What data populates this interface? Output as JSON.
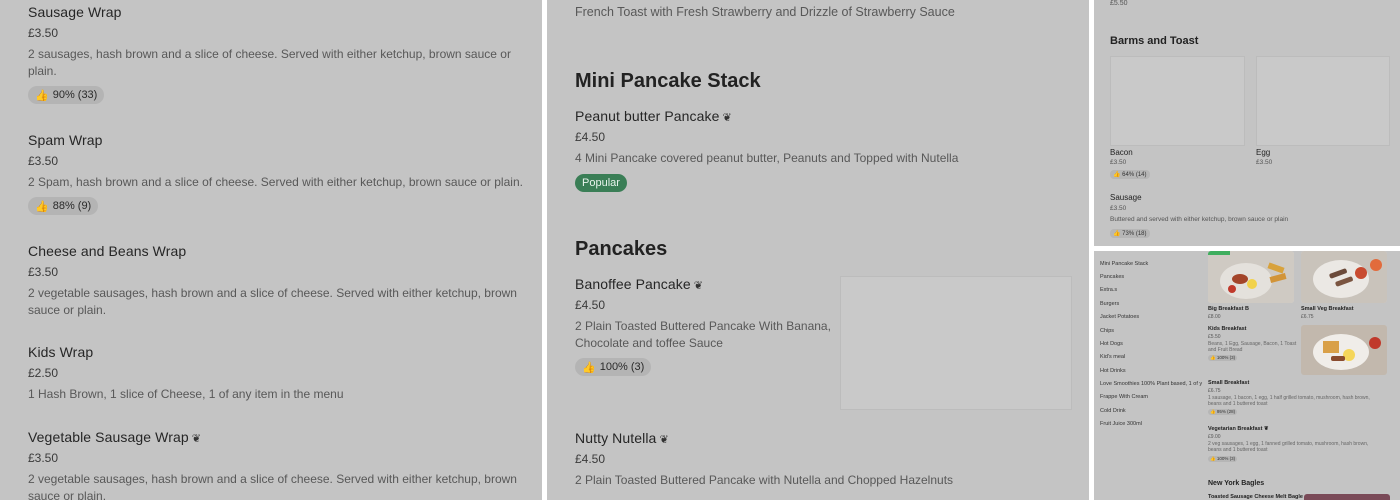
{
  "left": {
    "items": [
      {
        "name": "Sausage Wrap",
        "price": "£3.50",
        "desc": "2 sausages, hash brown and a slice of cheese. Served with either ketchup, brown sauce or plain.",
        "rating": "90% (33)"
      },
      {
        "name": "Spam Wrap",
        "price": "£3.50",
        "desc": "2 Spam, hash brown and a slice of cheese. Served with either ketchup, brown sauce or plain.",
        "rating": "88% (9)"
      },
      {
        "name": "Cheese and Beans Wrap",
        "price": "£3.50",
        "desc": "2 vegetable sausages, hash brown and a slice of cheese. Served with either ketchup, brown sauce or plain."
      },
      {
        "name": "Kids Wrap",
        "price": "£2.50",
        "desc": "1 Hash Brown, 1 slice of Cheese, 1 of any item in the menu"
      },
      {
        "name": "Vegetable Sausage Wrap",
        "price": "£3.50",
        "desc": "2 vegetable sausages, hash brown and a slice of cheese. Served with either ketchup, brown sauce or plain."
      }
    ]
  },
  "middle": {
    "top_line": "French Toast with Fresh Strawberry and Drizzle of Strawberry Sauce",
    "section1": "Mini Pancake Stack",
    "item1": {
      "name": "Peanut butter Pancake",
      "price": "£4.50",
      "desc": "4 Mini Pancake covered peanut butter, Peanuts and Topped with Nutella",
      "badge": "Popular"
    },
    "section2": "Pancakes",
    "item2": {
      "name": "Banoffee Pancake",
      "price": "£4.50",
      "desc": "2 Plain Toasted Buttered Pancake With Banana, Chocolate and toffee Sauce",
      "rating": "100% (3)"
    },
    "item3": {
      "name": "Nutty Nutella",
      "price": "£4.50",
      "desc": "2 Plain Toasted Buttered Pancake with Nutella and Chopped Hazelnuts"
    }
  },
  "right_top": {
    "top_price": "£5.50",
    "section": "Barms and Toast",
    "cards": [
      {
        "name": "Bacon",
        "price": "£3.50",
        "rating": "64% (14)"
      },
      {
        "name": "Egg",
        "price": "£3.50"
      }
    ],
    "item": {
      "name": "Sausage",
      "price": "£3.50",
      "desc": "Buttered and served with either ketchup, brown sauce or plain",
      "rating": "73% (18)"
    }
  },
  "right_bottom": {
    "sidebar": [
      "Mini Pancake Stack",
      "Pancakes",
      "Extra.s",
      "Burgers",
      "Jacket Potatoes",
      "Chips",
      "Hot Dogs",
      "Kid's meal",
      "Hot Drinks",
      "Love Smoothies 100% Plant based, 1 of y",
      "Frappe With Cream",
      "Cold Drink",
      "Fruit Juice 300ml"
    ],
    "tiles": [
      {
        "name": "Big Breakfast B",
        "price": "£8.00"
      },
      {
        "name": "Small Veg Breakfast",
        "price": "£6.75"
      }
    ],
    "kids": {
      "name": "Kids Breakfast",
      "price": "£5.50",
      "desc": "Beans, 1 Egg, Sausage, Bacon, 1 Toast and Fruit Bread",
      "rating": "100% (3)"
    },
    "small": {
      "name": "Small Breakfast",
      "price": "£6.75",
      "desc": "1 sausage, 1 bacon, 1 egg, 1 half grilled tomato, mushroom, hash brown, beans and 1 buttered toast",
      "rating": "95% (28)"
    },
    "veg": {
      "name": "Vegetarian Breakfast",
      "price": "£9.00",
      "desc": "2 veg sausages, 1 egg, 1 fanned grilled tomato, mushroom, hash brown, beans and 1 buttered toast",
      "rating": "100% (3)"
    },
    "section": "New York Bagles",
    "bagel": {
      "name": "Toasted Sausage Cheese Melt Bagle"
    }
  }
}
